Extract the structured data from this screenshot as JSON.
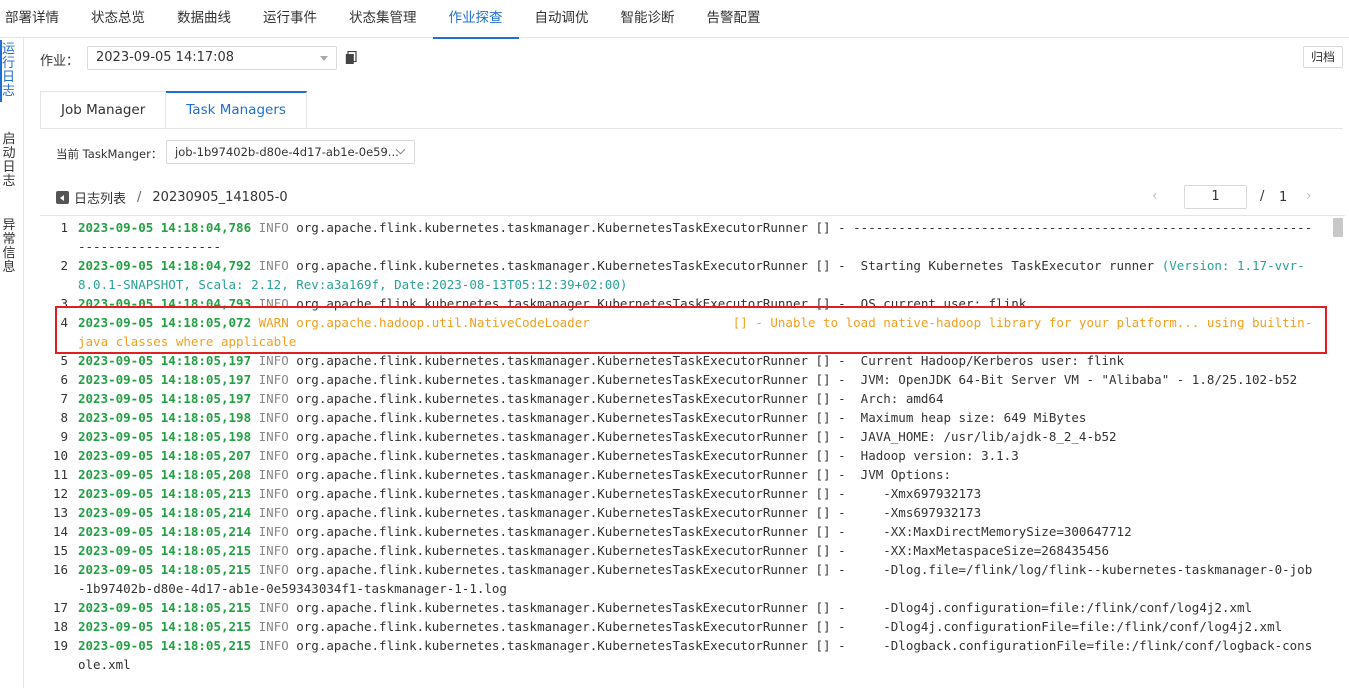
{
  "top_tabs": [
    "部署详情",
    "状态总览",
    "数据曲线",
    "运行事件",
    "状态集管理",
    "作业探查",
    "自动调优",
    "智能诊断",
    "告警配置"
  ],
  "active_top_tab": "作业探查",
  "side_tabs": [
    "运行日志",
    "启动日志",
    "异常信息"
  ],
  "job": {
    "label": "作业：",
    "value": "2023-09-05 14:17:08"
  },
  "archive_label": "归档",
  "manager_tabs": [
    "Job Manager",
    "Task Managers"
  ],
  "active_manager_tab": "Task Managers",
  "task_manager": {
    "label": "当前 TaskManger：",
    "value": "job-1b97402b-d80e-4d17-ab1e-0e59..."
  },
  "breadcrumb": {
    "back_label": "日志列表",
    "separator": "/",
    "current": "20230905_141805-0"
  },
  "pagination": {
    "current": "1",
    "slash": "/",
    "total": "1"
  },
  "log_lines": [
    {
      "n": "1",
      "ts": "2023-09-05 14:18:04,786",
      "lvl": "INFO",
      "msg": " org.apache.flink.kubernetes.taskmanager.KubernetesTaskExecutorRunner [] - --------------------------------------------------------------------------------"
    },
    {
      "n": "2",
      "ts": "2023-09-05 14:18:04,792",
      "lvl": "INFO",
      "msg": " org.apache.flink.kubernetes.taskmanager.KubernetesTaskExecutorRunner [] -  Starting Kubernetes TaskExecutor runner ",
      "ver": "(Version: 1.17-vvr-8.0.1-SNAPSHOT, Scala: 2.12, Rev:a3a169f, Date:2023-08-13T05:12:39+02:00)"
    },
    {
      "n": "3",
      "ts": "2023-09-05 14:18:04,793",
      "lvl": "INFO",
      "msg": " org.apache.flink.kubernetes.taskmanager.KubernetesTaskExecutorRunner [] -  OS current user: flink"
    },
    {
      "n": "4",
      "ts": "2023-09-05 14:18:05,072",
      "lvl": "WARN",
      "msg": " org.apache.hadoop.util.NativeCodeLoader                   [] - Unable to load native-hadoop library for your platform... using builtin-java classes where applicable",
      "warn": true
    },
    {
      "n": "5",
      "ts": "2023-09-05 14:18:05,197",
      "lvl": "INFO",
      "msg": " org.apache.flink.kubernetes.taskmanager.KubernetesTaskExecutorRunner [] -  Current Hadoop/Kerberos user: flink"
    },
    {
      "n": "6",
      "ts": "2023-09-05 14:18:05,197",
      "lvl": "INFO",
      "msg": " org.apache.flink.kubernetes.taskmanager.KubernetesTaskExecutorRunner [] -  JVM: OpenJDK 64-Bit Server VM - \"Alibaba\" - 1.8/25.102-b52"
    },
    {
      "n": "7",
      "ts": "2023-09-05 14:18:05,197",
      "lvl": "INFO",
      "msg": " org.apache.flink.kubernetes.taskmanager.KubernetesTaskExecutorRunner [] -  Arch: amd64"
    },
    {
      "n": "8",
      "ts": "2023-09-05 14:18:05,198",
      "lvl": "INFO",
      "msg": " org.apache.flink.kubernetes.taskmanager.KubernetesTaskExecutorRunner [] -  Maximum heap size: 649 MiBytes"
    },
    {
      "n": "9",
      "ts": "2023-09-05 14:18:05,198",
      "lvl": "INFO",
      "msg": " org.apache.flink.kubernetes.taskmanager.KubernetesTaskExecutorRunner [] -  JAVA_HOME: /usr/lib/ajdk-8_2_4-b52"
    },
    {
      "n": "10",
      "ts": "2023-09-05 14:18:05,207",
      "lvl": "INFO",
      "msg": " org.apache.flink.kubernetes.taskmanager.KubernetesTaskExecutorRunner [] -  Hadoop version: 3.1.3"
    },
    {
      "n": "11",
      "ts": "2023-09-05 14:18:05,208",
      "lvl": "INFO",
      "msg": " org.apache.flink.kubernetes.taskmanager.KubernetesTaskExecutorRunner [] -  JVM Options:"
    },
    {
      "n": "12",
      "ts": "2023-09-05 14:18:05,213",
      "lvl": "INFO",
      "msg": " org.apache.flink.kubernetes.taskmanager.KubernetesTaskExecutorRunner [] -     -Xmx697932173"
    },
    {
      "n": "13",
      "ts": "2023-09-05 14:18:05,214",
      "lvl": "INFO",
      "msg": " org.apache.flink.kubernetes.taskmanager.KubernetesTaskExecutorRunner [] -     -Xms697932173"
    },
    {
      "n": "14",
      "ts": "2023-09-05 14:18:05,214",
      "lvl": "INFO",
      "msg": " org.apache.flink.kubernetes.taskmanager.KubernetesTaskExecutorRunner [] -     -XX:MaxDirectMemorySize=300647712"
    },
    {
      "n": "15",
      "ts": "2023-09-05 14:18:05,215",
      "lvl": "INFO",
      "msg": " org.apache.flink.kubernetes.taskmanager.KubernetesTaskExecutorRunner [] -     -XX:MaxMetaspaceSize=268435456"
    },
    {
      "n": "16",
      "ts": "2023-09-05 14:18:05,215",
      "lvl": "INFO",
      "msg": " org.apache.flink.kubernetes.taskmanager.KubernetesTaskExecutorRunner [] -     -Dlog.file=/flink/log/flink--kubernetes-taskmanager-0-job-1b97402b-d80e-4d17-ab1e-0e59343034f1-taskmanager-1-1.log"
    },
    {
      "n": "17",
      "ts": "2023-09-05 14:18:05,215",
      "lvl": "INFO",
      "msg": " org.apache.flink.kubernetes.taskmanager.KubernetesTaskExecutorRunner [] -     -Dlog4j.configuration=file:/flink/conf/log4j2.xml"
    },
    {
      "n": "18",
      "ts": "2023-09-05 14:18:05,215",
      "lvl": "INFO",
      "msg": " org.apache.flink.kubernetes.taskmanager.KubernetesTaskExecutorRunner [] -     -Dlog4j.configurationFile=file:/flink/conf/log4j2.xml"
    },
    {
      "n": "19",
      "ts": "2023-09-05 14:18:05,215",
      "lvl": "INFO",
      "msg": " org.apache.flink.kubernetes.taskmanager.KubernetesTaskExecutorRunner [] -     -Dlogback.configurationFile=file:/flink/conf/logback-console.xml"
    }
  ],
  "colors": {
    "accent": "#1f6fd1",
    "timestamp": "#22a143",
    "warn": "#f0a020",
    "highlight": "#e02020"
  }
}
